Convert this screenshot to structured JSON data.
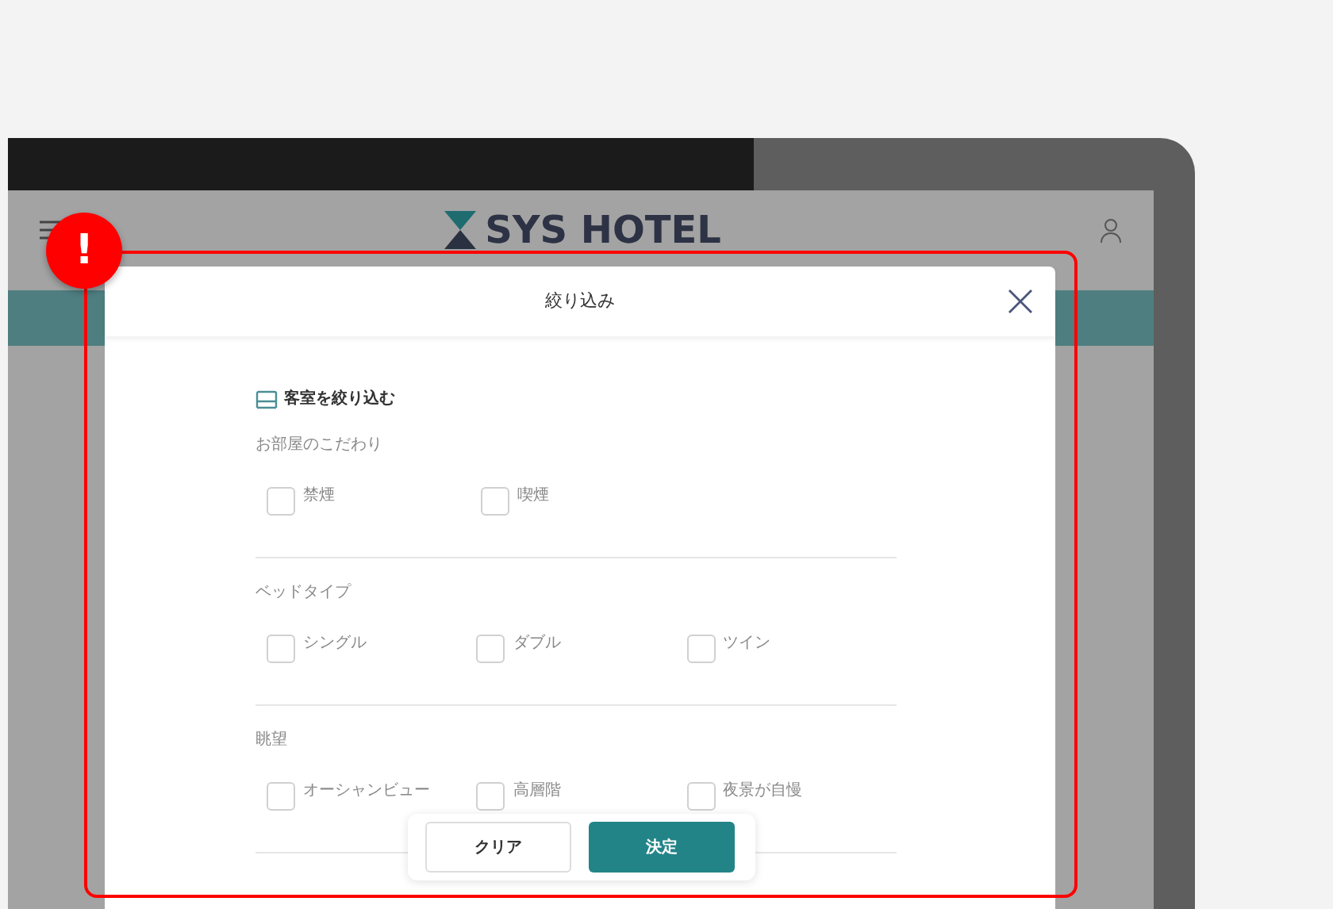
{
  "header": {
    "logo": "SYS HOTEL"
  },
  "modal": {
    "title": "絞り込み",
    "section_title": "客室を絞り込む",
    "groups": [
      {
        "label": "お部屋のこだわり",
        "options": [
          {
            "label": "禁煙",
            "checked": false
          },
          {
            "label": "喫煙",
            "checked": false
          }
        ]
      },
      {
        "label": "ベッドタイプ",
        "options": [
          {
            "label": "シングル",
            "checked": false
          },
          {
            "label": "ダブル",
            "checked": false
          },
          {
            "label": "ツイン",
            "checked": false
          }
        ]
      },
      {
        "label": "眺望",
        "options": [
          {
            "label": "オーシャンビュー",
            "checked": false
          },
          {
            "label": "高層階",
            "checked": false
          },
          {
            "label": "夜景が自慢",
            "checked": false
          }
        ]
      }
    ],
    "buttons": {
      "clear": "クリア",
      "apply": "決定"
    }
  },
  "alert": {
    "badge": "!"
  }
}
